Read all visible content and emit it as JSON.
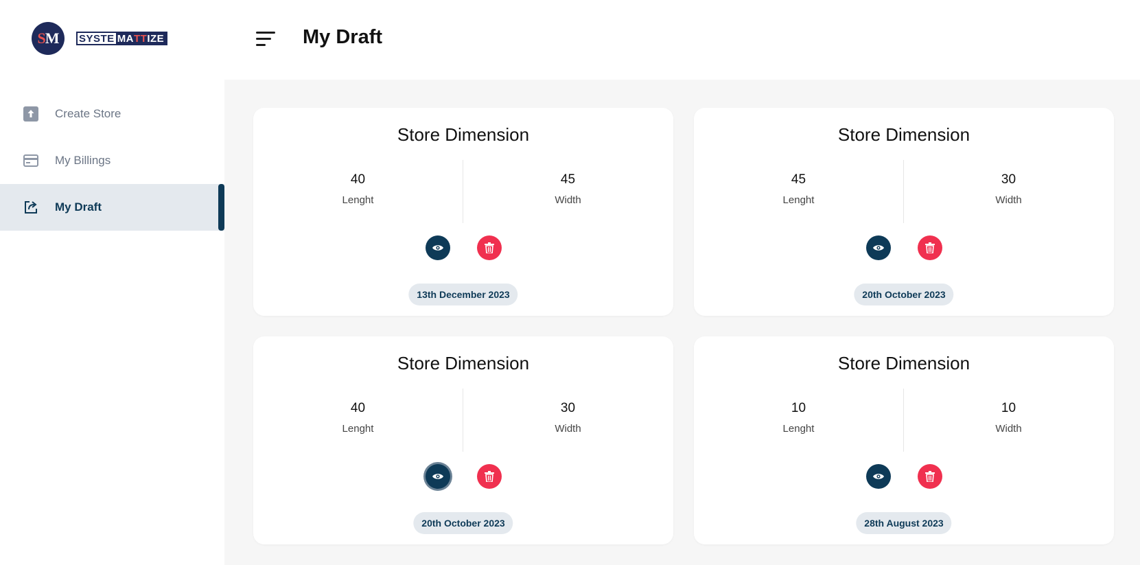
{
  "app": {
    "logo_mark_s": "S",
    "logo_mark_m": "M",
    "logo_word_a": "SYSTE",
    "logo_word_b1": "MA",
    "logo_word_b2": "TT",
    "logo_word_b3": "IZE"
  },
  "sidebar": {
    "items": [
      {
        "label": "Create Store",
        "icon": "upload-icon",
        "active": false
      },
      {
        "label": "My Billings",
        "icon": "credit-card-icon",
        "active": false
      },
      {
        "label": "My Draft",
        "icon": "edit-external-icon",
        "active": true
      }
    ]
  },
  "header": {
    "title": "My Draft",
    "menu_icon": "hamburger-icon"
  },
  "drafts": [
    {
      "title": "Store Dimension",
      "length_value": "40",
      "length_label": "Lenght",
      "width_value": "45",
      "width_label": "Width",
      "date": "13th December 2023"
    },
    {
      "title": "Store Dimension",
      "length_value": "45",
      "length_label": "Lenght",
      "width_value": "30",
      "width_label": "Width",
      "date": "20th October 2023"
    },
    {
      "title": "Store Dimension",
      "length_value": "40",
      "length_label": "Lenght",
      "width_value": "30",
      "width_label": "Width",
      "date": "20th October 2023"
    },
    {
      "title": "Store Dimension",
      "length_value": "10",
      "length_label": "Lenght",
      "width_value": "10",
      "width_label": "Width",
      "date": "28th August 2023"
    }
  ],
  "colors": {
    "primary": "#0e3a57",
    "danger": "#f0304f",
    "badge_bg": "#e4e9ee",
    "content_bg": "#f6f6f6"
  }
}
